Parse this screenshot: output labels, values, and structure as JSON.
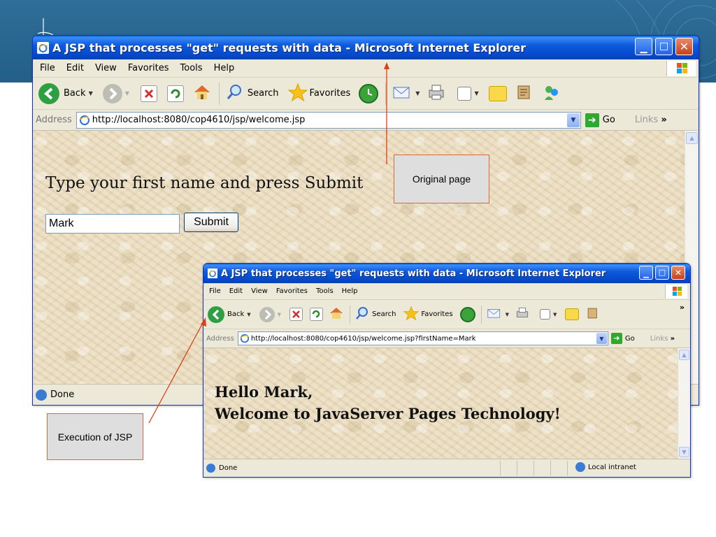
{
  "colors": {
    "banner": "#2a6690",
    "xp_title": "#0a55d2",
    "callout_border": "#d86a3a",
    "callout_fill": "#dedede",
    "callout_line": "#d9411b"
  },
  "window1": {
    "title": "A JSP that processes \"get\" requests with data - Microsoft Internet Explorer",
    "menu": [
      "File",
      "Edit",
      "View",
      "Favorites",
      "Tools",
      "Help"
    ],
    "toolbar": {
      "back": "Back",
      "search": "Search",
      "favorites": "Favorites"
    },
    "address_label": "Address",
    "address_value": "http://localhost:8080/cop4610/jsp/welcome.jsp",
    "go": "Go",
    "links": "Links",
    "prompt": "Type your first name and press Submit",
    "input_value": "Mark",
    "submit": "Submit",
    "status": "Done"
  },
  "window2": {
    "title": "A JSP that processes \"get\" requests with data - Microsoft Internet Explorer",
    "menu": [
      "File",
      "Edit",
      "View",
      "Favorites",
      "Tools",
      "Help"
    ],
    "toolbar": {
      "back": "Back",
      "search": "Search",
      "favorites": "Favorites"
    },
    "address_label": "Address",
    "address_value": "http://localhost:8080/cop4610/jsp/welcome.jsp?firstName=Mark",
    "go": "Go",
    "links": "Links",
    "greeting_line1": "Hello Mark,",
    "greeting_line2": "Welcome to JavaServer Pages Technology!",
    "status": "Done",
    "zone": "Local intranet"
  },
  "callouts": {
    "original": "Original page",
    "execution": "Execution of JSP"
  },
  "icons": [
    "ie-page-icon",
    "back-arrow-icon",
    "forward-arrow-icon",
    "stop-icon",
    "refresh-icon",
    "home-icon",
    "search-icon",
    "favorites-star-icon",
    "history-icon",
    "mail-icon",
    "print-icon",
    "edit-icon",
    "messenger-icon",
    "research-icon",
    "contacts-icon",
    "go-arrow-icon",
    "windows-logo-icon",
    "globe-icon"
  ]
}
